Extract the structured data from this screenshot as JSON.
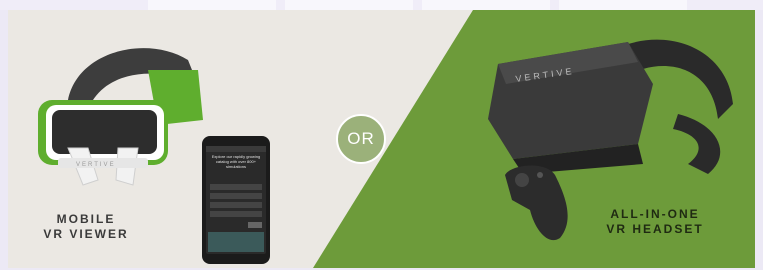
{
  "center_badge": {
    "label": "OR"
  },
  "left_product": {
    "line1": "MOBILE",
    "line2": "VR VIEWER",
    "headset_brand": "VERTIVE",
    "phone_screen_text": "Explore our rapidly growing catalog with over 800+ simulations"
  },
  "right_product": {
    "line1": "ALL-IN-ONE",
    "line2": "VR HEADSET",
    "headset_brand": "VERTIVE"
  },
  "colors": {
    "green_panel": "#6d9b3a",
    "light_panel": "#ebe8e3",
    "viewer_green": "#5fae2e",
    "headset_dark": "#2c2c2c"
  }
}
